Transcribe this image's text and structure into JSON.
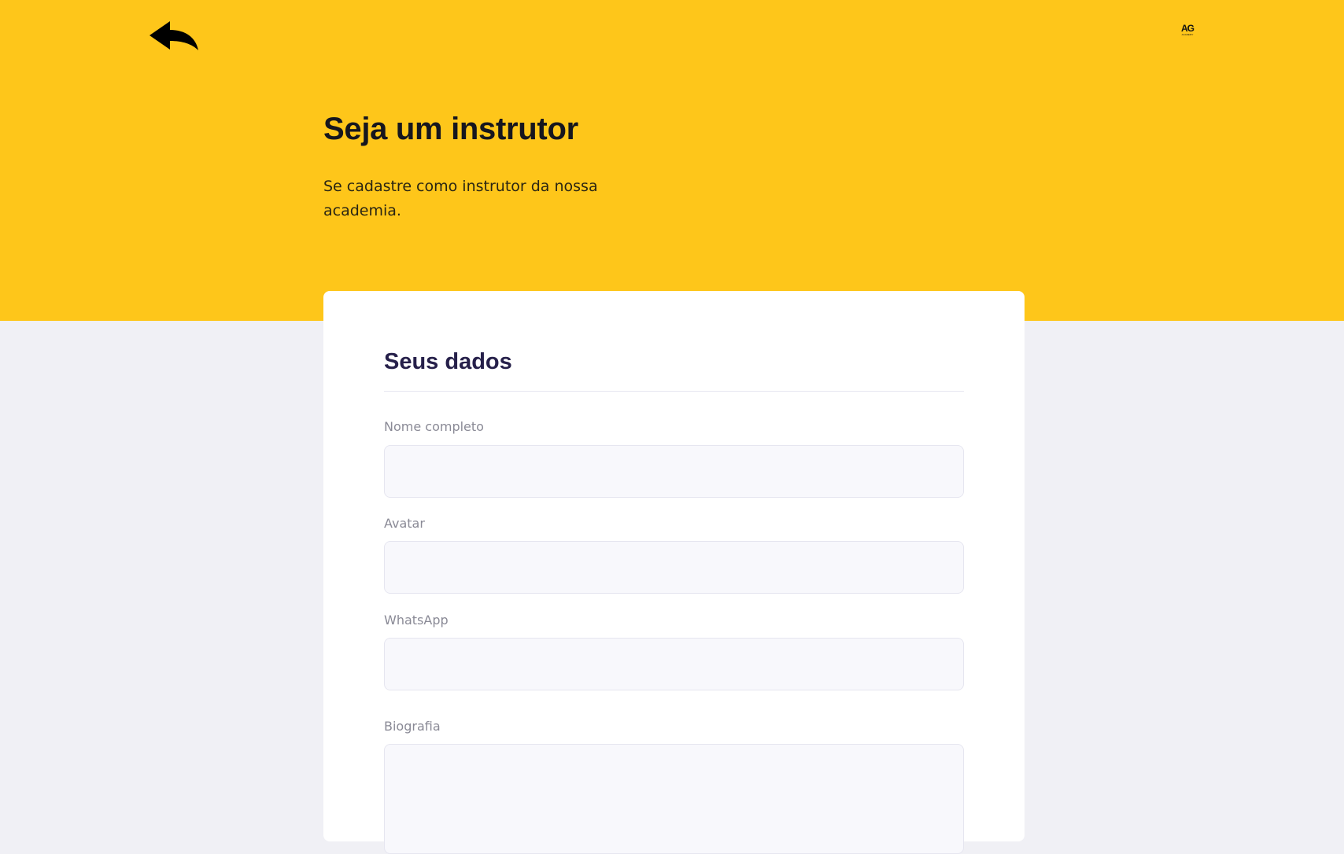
{
  "header": {
    "back_icon": "back-arrow-icon",
    "logo_mark": "AG",
    "logo_subtext": "ACADEMY",
    "background_color": "#FEC61A"
  },
  "hero": {
    "title": "Seja um instrutor",
    "subtitle": "Se cadastre como instrutor da nossa academia."
  },
  "form": {
    "section_title": "Seus dados",
    "fields": [
      {
        "label": "Nome completo",
        "value": "",
        "placeholder": ""
      },
      {
        "label": "Avatar",
        "value": "",
        "placeholder": ""
      },
      {
        "label": "WhatsApp",
        "value": "",
        "placeholder": ""
      },
      {
        "label": "Biografia",
        "value": "",
        "placeholder": ""
      }
    ]
  },
  "colors": {
    "accent": "#FEC61A",
    "page_background": "#F0F0F5",
    "card_background": "#FFFFFF",
    "section_title": "#26204A",
    "input_background": "#F8F8FC"
  }
}
